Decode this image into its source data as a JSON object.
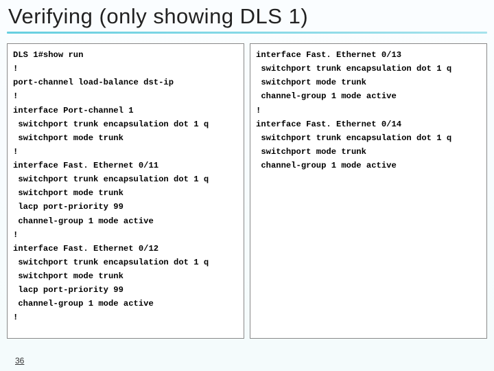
{
  "title": "Verifying (only showing DLS 1)",
  "page_number": "36",
  "left_code": "DLS 1#show run\n!\nport-channel load-balance dst-ip\n!\ninterface Port-channel 1\n switchport trunk encapsulation dot 1 q\n switchport mode trunk\n!\ninterface Fast. Ethernet 0/11\n switchport trunk encapsulation dot 1 q\n switchport mode trunk\n lacp port-priority 99\n channel-group 1 mode active\n!\ninterface Fast. Ethernet 0/12\n switchport trunk encapsulation dot 1 q\n switchport mode trunk\n lacp port-priority 99\n channel-group 1 mode active\n!",
  "right_code": "interface Fast. Ethernet 0/13\n switchport trunk encapsulation dot 1 q\n switchport mode trunk\n channel-group 1 mode active\n!\ninterface Fast. Ethernet 0/14\n switchport trunk encapsulation dot 1 q\n switchport mode trunk\n channel-group 1 mode active"
}
